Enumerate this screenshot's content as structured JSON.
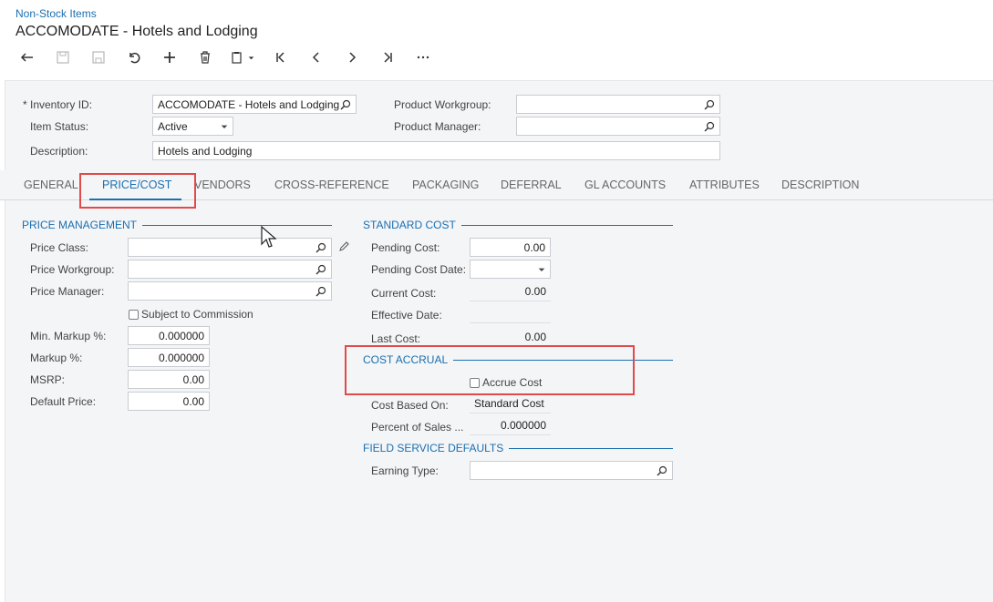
{
  "header": {
    "breadcrumb": "Non-Stock Items",
    "title": "ACCOMODATE - Hotels and Lodging"
  },
  "toolbar": {
    "items": [
      "back-icon",
      "save-icon",
      "save-close-icon",
      "undo-icon",
      "add-icon",
      "delete-icon",
      "copy-paste-icon",
      "first-icon",
      "prev-icon",
      "next-icon",
      "last-icon",
      "more-icon"
    ]
  },
  "form": {
    "inventory_id_label": "Inventory ID:",
    "inventory_id_required": "*",
    "inventory_id_value": "ACCOMODATE - Hotels and Lodging",
    "item_status_label": "Item Status:",
    "item_status_value": "Active",
    "description_label": "Description:",
    "description_value": "Hotels and Lodging",
    "product_workgroup_label": "Product Workgroup:",
    "product_workgroup_value": "",
    "product_manager_label": "Product Manager:",
    "product_manager_value": ""
  },
  "tabs": [
    "GENERAL",
    "PRICE/COST",
    "VENDORS",
    "CROSS-REFERENCE",
    "PACKAGING",
    "DEFERRAL",
    "GL ACCOUNTS",
    "ATTRIBUTES",
    "DESCRIPTION"
  ],
  "active_tab": "PRICE/COST",
  "price_management": {
    "title": "PRICE MANAGEMENT",
    "price_class_label": "Price Class:",
    "price_class_value": "",
    "price_workgroup_label": "Price Workgroup:",
    "price_workgroup_value": "",
    "price_manager_label": "Price Manager:",
    "price_manager_value": "",
    "subject_to_commission_label": "Subject to Commission",
    "subject_to_commission_checked": false,
    "min_markup_label": "Min. Markup %:",
    "min_markup_value": "0.000000",
    "markup_label": "Markup %:",
    "markup_value": "0.000000",
    "msrp_label": "MSRP:",
    "msrp_value": "0.00",
    "default_price_label": "Default Price:",
    "default_price_value": "0.00"
  },
  "standard_cost": {
    "title": "STANDARD COST",
    "pending_cost_label": "Pending Cost:",
    "pending_cost_value": "0.00",
    "pending_cost_date_label": "Pending Cost Date:",
    "pending_cost_date_value": "",
    "current_cost_label": "Current Cost:",
    "current_cost_value": "0.00",
    "effective_date_label": "Effective Date:",
    "effective_date_value": "",
    "last_cost_label": "Last Cost:",
    "last_cost_value": "0.00"
  },
  "cost_accrual": {
    "title": "COST ACCRUAL",
    "accrue_cost_label": "Accrue Cost",
    "accrue_cost_checked": false,
    "cost_based_on_label": "Cost Based On:",
    "cost_based_on_value": "Standard Cost",
    "percent_of_sales_label": "Percent of Sales ...",
    "percent_of_sales_value": "0.000000"
  },
  "field_service": {
    "title": "FIELD SERVICE DEFAULTS",
    "earning_type_label": "Earning Type:",
    "earning_type_value": ""
  },
  "colors": {
    "accent": "#1a6fb0",
    "highlight": "#e24a4a",
    "panel_bg": "#f4f5f7"
  }
}
